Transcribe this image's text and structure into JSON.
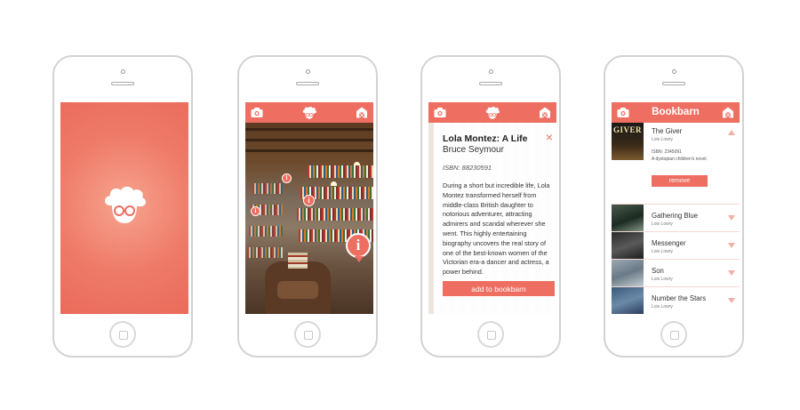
{
  "colors": {
    "accent": "#ee6e61",
    "accent_light": "#f6a48f",
    "divider": "#f3d8d2"
  },
  "splash": {
    "logo_icon": "reader-glasses-logo-icon"
  },
  "camera_view": {
    "header_icons": [
      "camera-icon",
      "reader-glasses-logo-icon",
      "barn-icon"
    ],
    "pin_glyph": "i"
  },
  "book_detail": {
    "title": "Lola Montez: A Life",
    "author": "Bruce Seymour",
    "isbn": "ISBN: 88230591",
    "description": "During a short but incredible life, Lola Montez transformed herself from middle-class British daughter to notorious adventurer, attracting admirers and scandal wherever she went. This highly entertaining biography uncovers the real story of one of the best-known women of the Victorian era-a dancer and actress, a power behind.",
    "close_glyph": "×",
    "add_button": "add to bookbarn"
  },
  "bookbarn": {
    "title": "Bookbarn",
    "expanded": {
      "title": "The Giver",
      "author": "Lois Lowry",
      "cover_text": "GIVER",
      "isbn": "ISBN: 2345091",
      "summary": "A dystopian children's novel.",
      "remove_button": "remove"
    },
    "books": [
      {
        "title": "Gathering Blue",
        "author": "Lois Lowry"
      },
      {
        "title": "Messenger",
        "author": "Lois Lowry"
      },
      {
        "title": "Son",
        "author": "Lois Lowry"
      },
      {
        "title": "Number the Stars",
        "author": "Lois Lowry"
      }
    ]
  }
}
